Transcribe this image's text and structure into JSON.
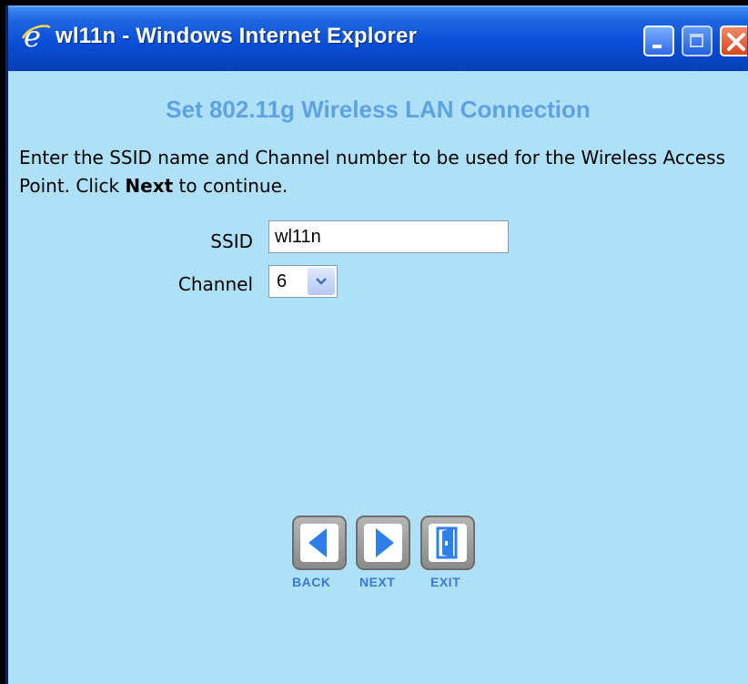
{
  "window": {
    "title": "wl11n - Windows Internet Explorer"
  },
  "page": {
    "heading": "Set 802.11g Wireless LAN Connection",
    "instructions_part1": "Enter the SSID name and Channel number to be used for the Wireless Access Point. Click ",
    "instructions_bold": "Next",
    "instructions_part2": " to continue."
  },
  "form": {
    "ssid_label": "SSID",
    "ssid_value": "wl11n",
    "channel_label": "Channel",
    "channel_value": "6"
  },
  "nav": {
    "back_label": "BACK",
    "next_label": "NEXT",
    "exit_label": "EXIT"
  },
  "colors": {
    "page_background": "#aee0f8",
    "heading": "#5ea2e0",
    "titlebar": "#0a4fd8",
    "nav_label": "#3a78d8",
    "icon_blue": "#2f7fe8"
  }
}
